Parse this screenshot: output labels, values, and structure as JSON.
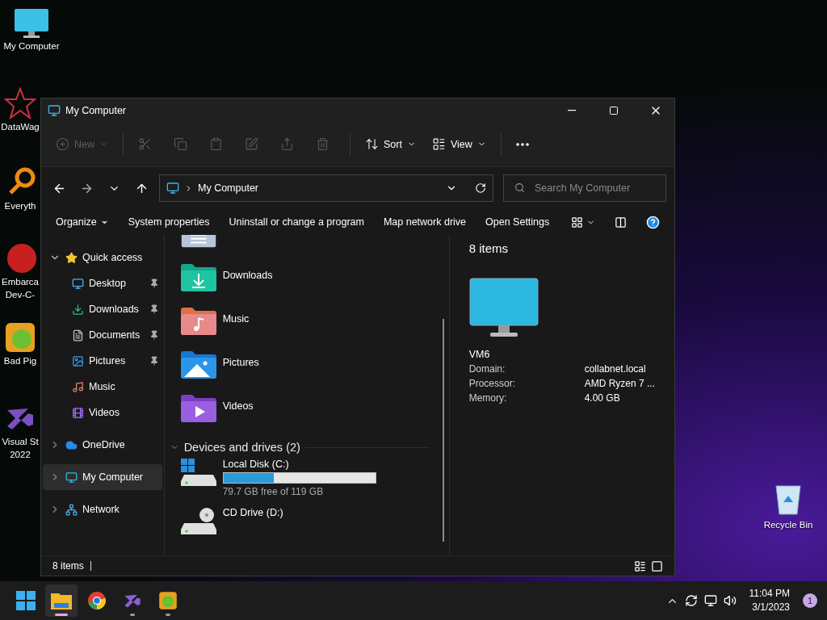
{
  "desktop_icons": [
    {
      "kind": "monitor",
      "lines": [
        "My Computer"
      ]
    },
    {
      "kind": "star",
      "lines": [
        "DataWag"
      ]
    },
    {
      "kind": "ring",
      "lines": [
        "Everyth"
      ]
    },
    {
      "kind": "dev",
      "lines": [
        "Embarca",
        "Dev-C-"
      ]
    },
    {
      "kind": "pig",
      "lines": [
        "Bad Pig"
      ]
    },
    {
      "kind": "vs",
      "lines": [
        "Visual St",
        "2022"
      ]
    }
  ],
  "recycle_bin": {
    "label": "Recycle Bin"
  },
  "window": {
    "title": "My Computer"
  },
  "command_bar": [
    {
      "kind": "new",
      "label": "New",
      "disabled": true
    },
    {
      "kind": "cut",
      "disabled": true
    },
    {
      "kind": "copy",
      "disabled": true
    },
    {
      "kind": "paste",
      "disabled": true
    },
    {
      "kind": "rename",
      "disabled": true
    },
    {
      "kind": "share",
      "disabled": true
    },
    {
      "kind": "delete",
      "disabled": true
    },
    {
      "kind": "sort",
      "label": "Sort",
      "disabled": false
    },
    {
      "kind": "view",
      "label": "View",
      "disabled": false
    },
    {
      "kind": "more",
      "disabled": false
    }
  ],
  "address": {
    "path": "My Computer"
  },
  "search": {
    "placeholder": "Search My Computer"
  },
  "ribbon": [
    "Organize",
    "System properties",
    "Uninstall or change a program",
    "Map network drive",
    "Open Settings"
  ],
  "nav": [
    {
      "label": "Quick access",
      "kind": "star",
      "expanded": true,
      "selected": false,
      "children": [
        {
          "label": "Desktop",
          "kind": "desktop",
          "pinned": true,
          "selected": false
        },
        {
          "label": "Downloads",
          "kind": "downloads",
          "pinned": true,
          "selected": false
        },
        {
          "label": "Documents",
          "kind": "documents",
          "pinned": true,
          "selected": false
        },
        {
          "label": "Pictures",
          "kind": "pictures",
          "pinned": true,
          "selected": false
        },
        {
          "label": "Music",
          "kind": "music",
          "pinned": false,
          "selected": false
        },
        {
          "label": "Videos",
          "kind": "videos",
          "pinned": false,
          "selected": false
        }
      ]
    },
    {
      "label": "OneDrive",
      "kind": "cloud",
      "expanded": false,
      "selected": false
    },
    {
      "label": "My Computer",
      "kind": "monitor",
      "expanded": false,
      "selected": true
    },
    {
      "label": "Network",
      "kind": "network",
      "expanded": false,
      "selected": false
    }
  ],
  "folders": [
    {
      "label": "Downloads",
      "kind": "downloads"
    },
    {
      "label": "Music",
      "kind": "music"
    },
    {
      "label": "Pictures",
      "kind": "pictures"
    },
    {
      "label": "Videos",
      "kind": "videos"
    }
  ],
  "drives_group": {
    "title": "Devices and drives (2)",
    "expanded": true
  },
  "drives": [
    {
      "label": "Local Disk (C:)",
      "kind": "hdd",
      "level": 0.33,
      "free": "79.7 GB free of 119 GB"
    },
    {
      "label": "CD Drive (D:)",
      "kind": "cd"
    }
  ],
  "details": {
    "count": "8 items",
    "name": "VM6",
    "props": [
      {
        "key": "Domain:",
        "value": "collabnet.local"
      },
      {
        "key": "Processor:",
        "value": "AMD Ryzen 7 ..."
      },
      {
        "key": "Memory:",
        "value": "4.00 GB"
      }
    ]
  },
  "status": {
    "count": "8 items"
  },
  "taskbar": {
    "apps": [
      {
        "kind": "start",
        "selected": false,
        "running": false
      },
      {
        "kind": "explorer",
        "selected": true,
        "running": true
      },
      {
        "kind": "chrome",
        "selected": false,
        "running": false
      },
      {
        "kind": "vs",
        "selected": false,
        "running": true
      },
      {
        "kind": "pig",
        "selected": false,
        "running": true
      }
    ],
    "time": "11:04 PM",
    "date": "3/1/2023",
    "badge": "1"
  }
}
